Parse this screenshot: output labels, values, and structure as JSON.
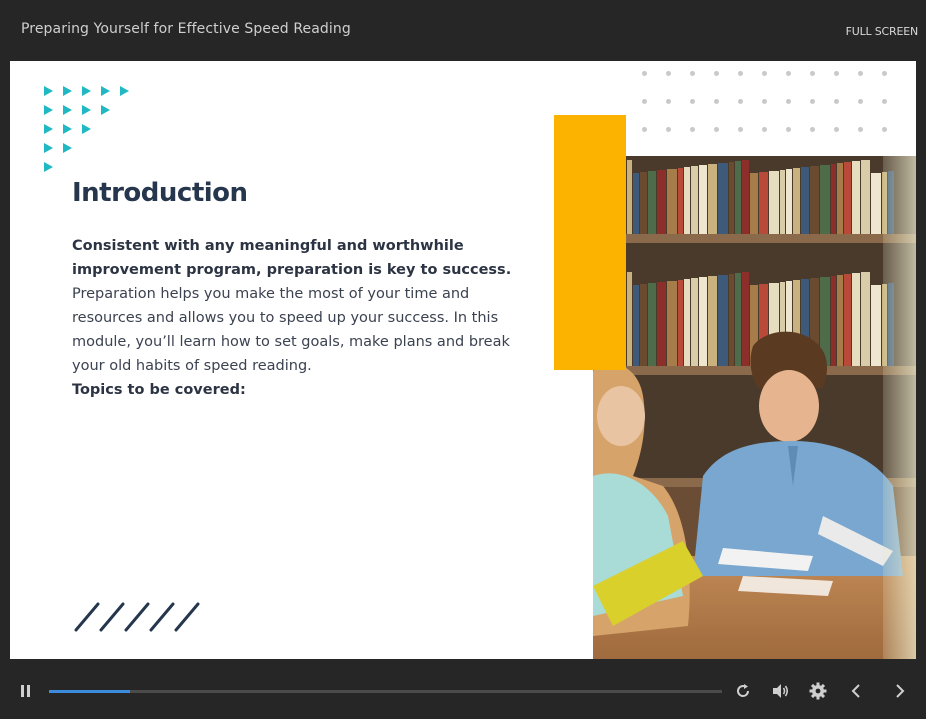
{
  "header": {
    "title": "Preparing Yourself for Effective Speed Reading",
    "fullscreen_label": "FULL SCREEN"
  },
  "slide": {
    "heading": "Introduction",
    "intro_bold": "Consistent with any meaningful and worthwhile improvement program, preparation is key to success.",
    "intro_rest": " Preparation helps you make the most of your time and resources and allows you to speed up your success. In this module, you’ll learn how to set goals, make plans and break your old habits of speed reading.",
    "topics_label": "Topics to be covered:"
  },
  "controls": {
    "progress": 0.12,
    "icons": [
      "pause-icon",
      "replay-icon",
      "volume-icon",
      "settings-icon",
      "previous-icon",
      "next-icon"
    ]
  },
  "colors": {
    "accent_teal": "#1fb8c3",
    "accent_orange": "#fcb300",
    "heading": "#25364d",
    "progress": "#3d8bdc"
  }
}
